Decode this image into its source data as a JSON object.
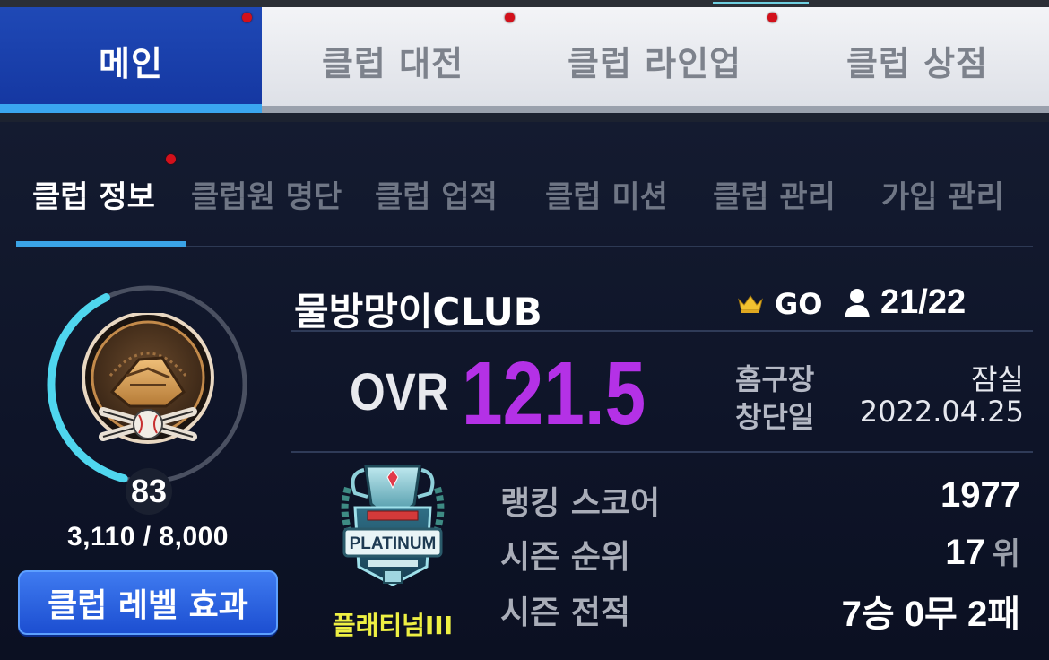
{
  "main_tabs": [
    {
      "label": "메인"
    },
    {
      "label": "클럽 대전"
    },
    {
      "label": "클럽 라인업"
    },
    {
      "label": "클럽 상점"
    }
  ],
  "sub_tabs": [
    {
      "label": "클럽 정보"
    },
    {
      "label": "클럽원 명단"
    },
    {
      "label": "클럽 업적"
    },
    {
      "label": "클럽 미션"
    },
    {
      "label": "클럽 관리"
    },
    {
      "label": "가입 관리"
    }
  ],
  "club": {
    "level": "83",
    "exp_text": "3,110 / 8,000",
    "exp_fraction": 0.389,
    "level_effect_label": "클럽 레벨 효과",
    "name": "물방망이CLUB",
    "grade_icon": "crown-icon",
    "grade": "GO",
    "members_icon": "person-icon",
    "members": "21/22",
    "ovr_label": "OVR",
    "ovr_value": "121.5",
    "home_label": "홈구장",
    "home_value": "잠실",
    "founded_label": "창단일",
    "founded_value": "2022.04.25",
    "tier_name": "플래티넘III",
    "emblem_text": "PLATINUM"
  },
  "stats": [
    {
      "label": "랭킹 스코어",
      "value": "1977",
      "unit": ""
    },
    {
      "label": "시즌 순위",
      "value": "17",
      "unit": "위"
    },
    {
      "label": "시즌 전적",
      "value": "7승 0무 2패",
      "unit": ""
    }
  ],
  "colors": {
    "active_tab": "#1f49b6",
    "ovr": "#b431e6",
    "tier": "#eef043",
    "ring": "#4fd6ee",
    "notification": "#d3101b"
  }
}
